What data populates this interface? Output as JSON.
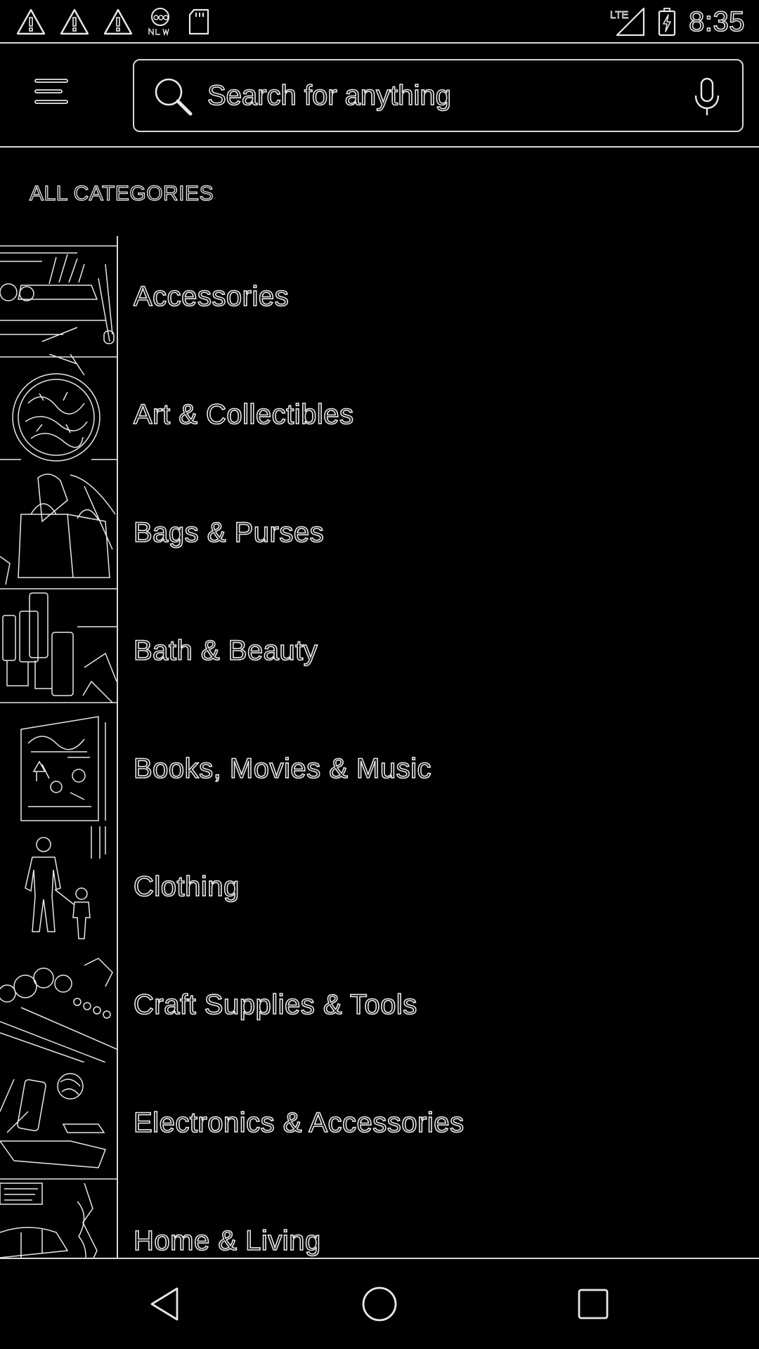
{
  "status_bar": {
    "time": "8:35",
    "notification_icons": [
      "warning-icon",
      "warning-icon",
      "warning-icon",
      "abc-news-icon",
      "sd-card-icon"
    ],
    "network": "LTE",
    "network_icon": "lte-signal-icon",
    "battery_icon": "battery-charging-icon"
  },
  "app_bar": {
    "menu_icon": "hamburger-menu-icon",
    "search": {
      "placeholder": "Search for anything",
      "value": "",
      "search_icon": "search-icon",
      "voice_icon": "microphone-icon"
    }
  },
  "categories": {
    "heading": "ALL CATEGORIES",
    "items": [
      {
        "label": "Accessories",
        "thumb": "accessories-thumbnail"
      },
      {
        "label": "Art & Collectibles",
        "thumb": "art-collectibles-thumbnail"
      },
      {
        "label": "Bags & Purses",
        "thumb": "bags-purses-thumbnail"
      },
      {
        "label": "Bath & Beauty",
        "thumb": "bath-beauty-thumbnail"
      },
      {
        "label": "Books, Movies & Music",
        "thumb": "books-movies-music-thumbnail"
      },
      {
        "label": "Clothing",
        "thumb": "clothing-thumbnail"
      },
      {
        "label": "Craft Supplies & Tools",
        "thumb": "craft-supplies-thumbnail"
      },
      {
        "label": "Electronics & Accessories",
        "thumb": "electronics-thumbnail"
      },
      {
        "label": "Home & Living",
        "thumb": "home-living-thumbnail"
      }
    ]
  },
  "nav_bar": {
    "back_icon": "back-triangle-icon",
    "home_icon": "home-circle-icon",
    "recents_icon": "recents-square-icon"
  },
  "colors": {
    "background": "#000000",
    "outline": "#e8e8e8"
  }
}
